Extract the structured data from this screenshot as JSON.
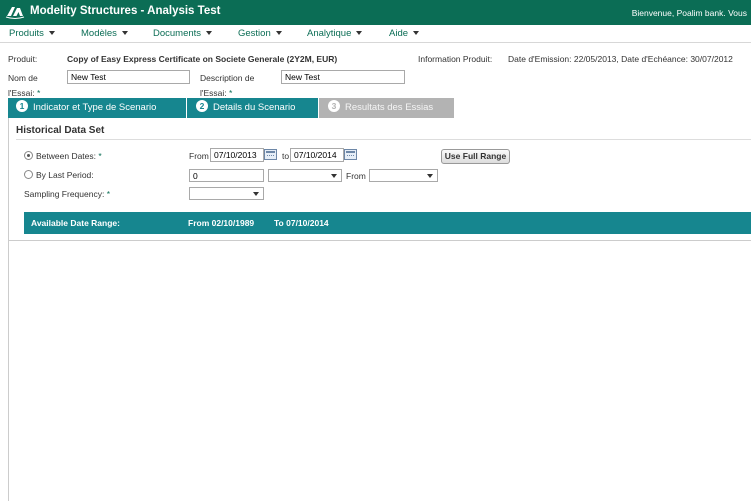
{
  "header": {
    "title": "Modelity Structures - Analysis Test",
    "welcome": "Bienvenue, Poalim bank. Vous"
  },
  "menu": [
    {
      "label": "Produits"
    },
    {
      "label": "Modèles"
    },
    {
      "label": "Documents"
    },
    {
      "label": "Gestion"
    },
    {
      "label": "Analytique"
    },
    {
      "label": "Aide"
    }
  ],
  "product": {
    "label": "Produit:",
    "value": "Copy of Easy Express Certificate on Societe Generale (2Y2M, EUR)",
    "info_label": "Information Produit:",
    "info_value": "Date d'Emission: 22/05/2013, Date d'Echéance: 30/07/2012"
  },
  "form": {
    "name_label_1": "Nom de",
    "name_label_2": "l'Essai:",
    "name_required": "*",
    "name_value": "New Test",
    "desc_label_1": "Description de",
    "desc_label_2": "l'Essai:",
    "desc_required": "*",
    "desc_value": "New Test"
  },
  "tabs": [
    {
      "num": "1",
      "label": "Indicator et Type de Scenario",
      "state": "active"
    },
    {
      "num": "2",
      "label": "Details du Scenario",
      "state": "active"
    },
    {
      "num": "3",
      "label": "Resultats des Essias",
      "state": "inactive"
    }
  ],
  "historical": {
    "title": "Historical Data Set",
    "between_label": "Between Dates:",
    "between_required": "*",
    "between_checked": true,
    "from_label": "From",
    "from_value": "07/10/2013",
    "to_label": "to",
    "to_value": "07/10/2014",
    "full_range_button": "Use Full Range",
    "last_period_label": "By Last Period:",
    "last_period_checked": false,
    "last_period_value": "0",
    "last_period_unit": "",
    "last_period_from_label": "From",
    "last_period_from_value": "",
    "sampling_label": "Sampling Frequency:",
    "sampling_required": "*",
    "sampling_value": ""
  },
  "available_range": {
    "label": "Available Date Range:",
    "from": "From 02/10/1989",
    "to": "To 07/10/2014"
  },
  "colors": {
    "brand_green": "#0b6d55",
    "tab_teal": "#16868f",
    "tab_inactive": "#b3b3b3"
  },
  "icons": {
    "logo": "ca-logo-icon",
    "calendar": "calendar-icon",
    "dropdown": "chevron-down-icon"
  }
}
